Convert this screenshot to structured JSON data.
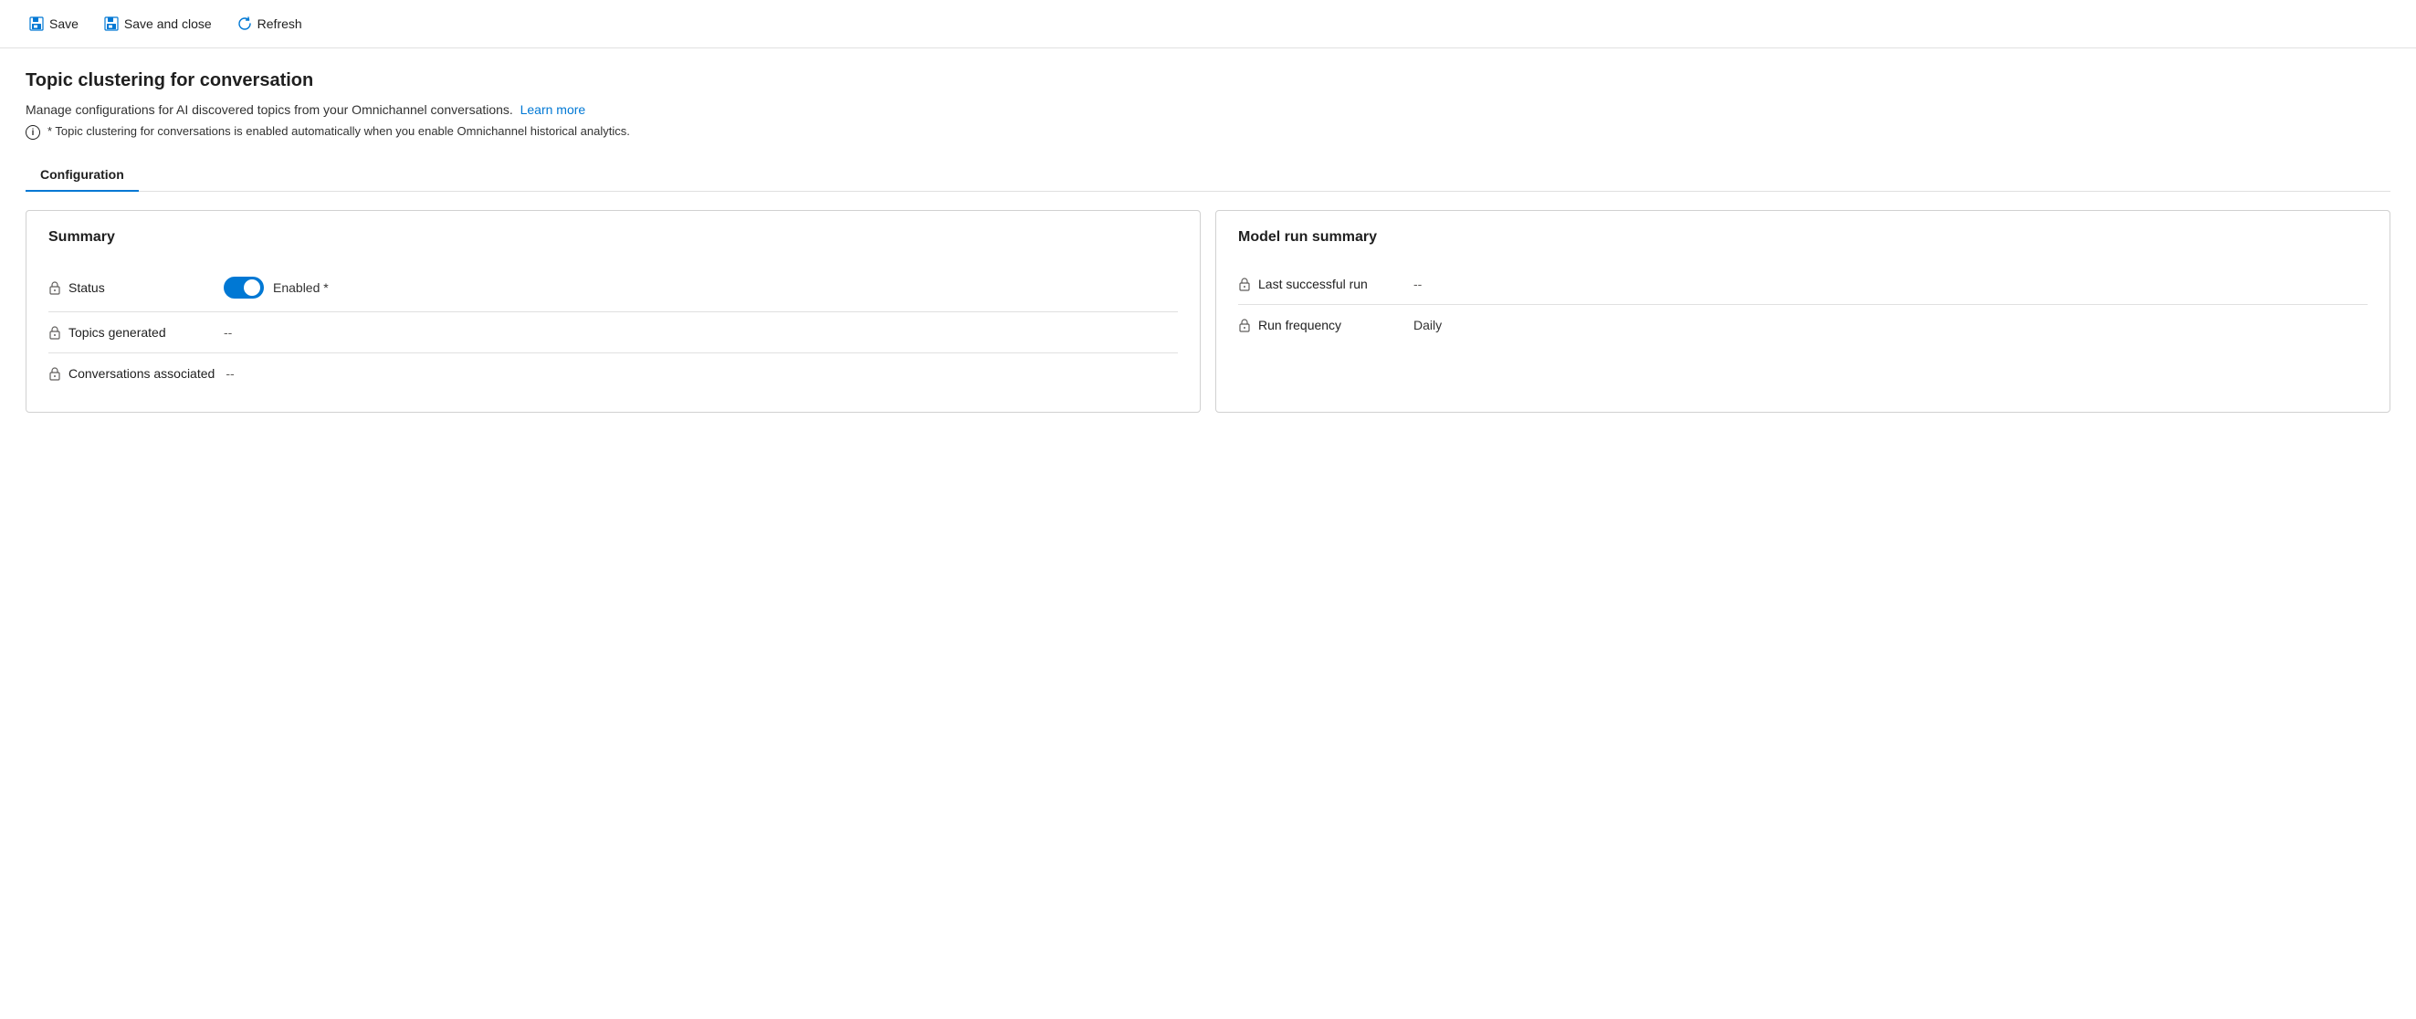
{
  "toolbar": {
    "save_label": "Save",
    "save_and_close_label": "Save and close",
    "refresh_label": "Refresh"
  },
  "page": {
    "title": "Topic clustering for conversation",
    "description": "Manage configurations for AI discovered topics from your Omnichannel conversations.",
    "learn_more_text": "Learn more",
    "note_text": "* Topic clustering for conversations is enabled automatically when you enable Omnichannel historical analytics."
  },
  "tabs": [
    {
      "label": "Configuration",
      "active": true
    }
  ],
  "summary_card": {
    "title": "Summary",
    "fields": [
      {
        "label": "Status",
        "type": "toggle",
        "toggle_enabled": true,
        "toggle_label": "Enabled *"
      },
      {
        "label": "Topics generated",
        "value": "--"
      },
      {
        "label": "Conversations associated",
        "value": "--"
      }
    ]
  },
  "model_run_card": {
    "title": "Model run summary",
    "fields": [
      {
        "label": "Last successful run",
        "value": "--"
      },
      {
        "label": "Run frequency",
        "value": "Daily"
      }
    ]
  },
  "icons": {
    "lock": "🔒",
    "info": "i"
  }
}
